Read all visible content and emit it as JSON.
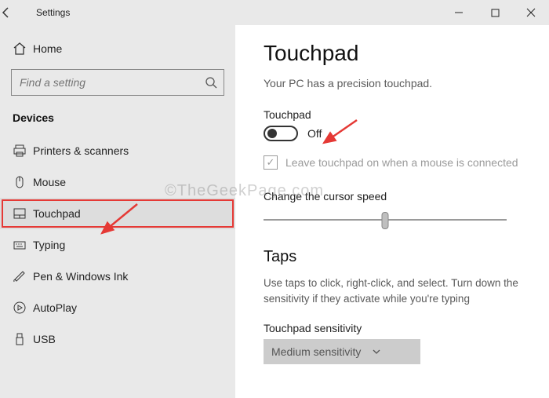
{
  "titlebar": {
    "title": "Settings"
  },
  "sidebar": {
    "home": "Home",
    "search_placeholder": "Find a setting",
    "section": "Devices",
    "items": [
      {
        "label": "Printers & scanners"
      },
      {
        "label": "Mouse"
      },
      {
        "label": "Touchpad"
      },
      {
        "label": "Typing"
      },
      {
        "label": "Pen & Windows Ink"
      },
      {
        "label": "AutoPlay"
      },
      {
        "label": "USB"
      }
    ]
  },
  "content": {
    "heading": "Touchpad",
    "precision_text": "Your PC has a precision touchpad.",
    "touchpad_label": "Touchpad",
    "toggle_state": "Off",
    "leave_on_label": "Leave touchpad on when a mouse is connected",
    "cursor_speed_label": "Change the cursor speed",
    "taps_heading": "Taps",
    "taps_desc": "Use taps to click, right-click, and select. Turn down the sensitivity if they activate while you're typing",
    "sensitivity_label": "Touchpad sensitivity",
    "sensitivity_value": "Medium sensitivity"
  },
  "watermark": "©TheGeekPage.com"
}
